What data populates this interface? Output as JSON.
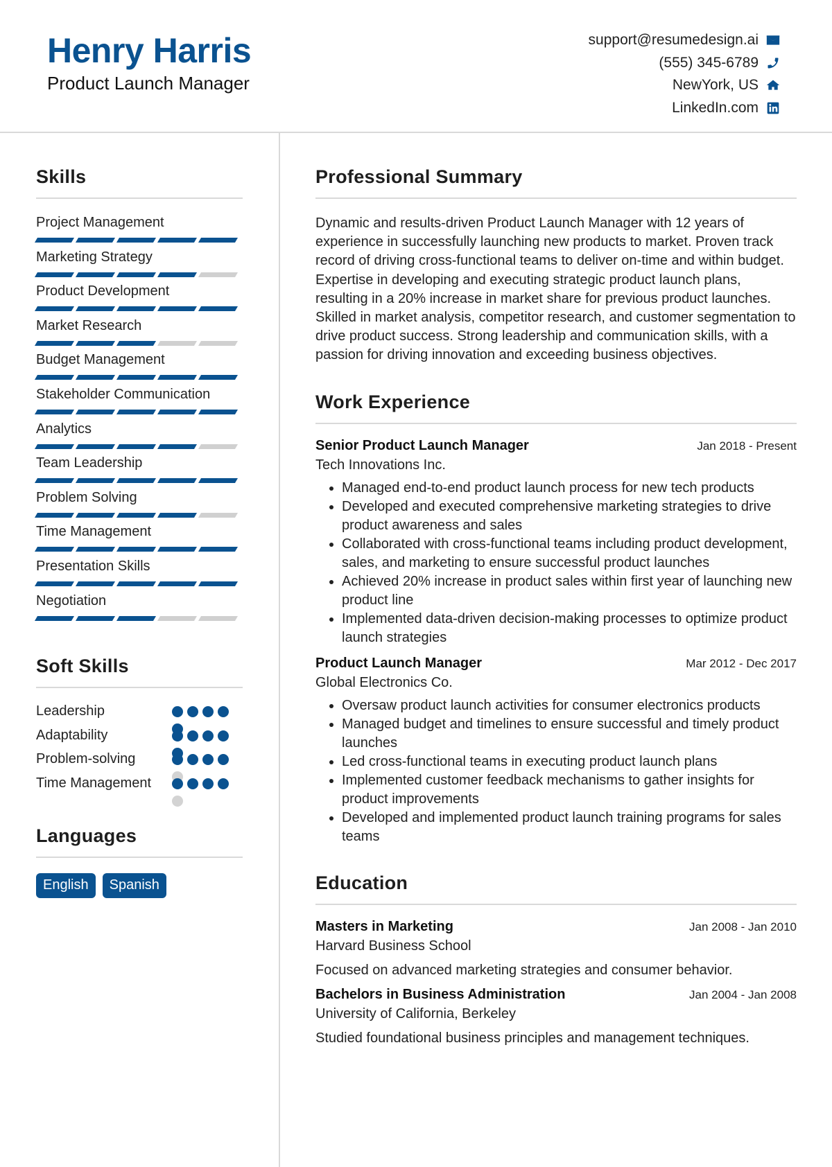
{
  "header": {
    "name": "Henry Harris",
    "title": "Product Launch Manager",
    "contacts": [
      {
        "text": "support@resumedesign.ai",
        "icon": "envelope-icon"
      },
      {
        "text": "(555) 345-6789",
        "icon": "phone-icon"
      },
      {
        "text": "NewYork, US",
        "icon": "home-icon"
      },
      {
        "text": "LinkedIn.com",
        "icon": "linkedin-icon"
      }
    ]
  },
  "colors": {
    "accent": "#0a5290",
    "inactive": "#d3d3d3",
    "rule": "#d9d9d9"
  },
  "skills": {
    "title": "Skills",
    "max": 5,
    "items": [
      {
        "label": "Project Management",
        "level": 5
      },
      {
        "label": "Marketing Strategy",
        "level": 4
      },
      {
        "label": "Product Development",
        "level": 5
      },
      {
        "label": "Market Research",
        "level": 3
      },
      {
        "label": "Budget Management",
        "level": 5
      },
      {
        "label": "Stakeholder Communication",
        "level": 5
      },
      {
        "label": "Analytics",
        "level": 4
      },
      {
        "label": "Team Leadership",
        "level": 5
      },
      {
        "label": "Problem Solving",
        "level": 4
      },
      {
        "label": "Time Management",
        "level": 5
      },
      {
        "label": "Presentation Skills",
        "level": 5
      },
      {
        "label": "Negotiation",
        "level": 3
      }
    ]
  },
  "soft_skills": {
    "title": "Soft Skills",
    "max": 5,
    "items": [
      {
        "label": "Leadership",
        "level": 5
      },
      {
        "label": "Adaptability",
        "level": 5
      },
      {
        "label": "Problem-solving",
        "level": 4
      },
      {
        "label": "Time Management",
        "level": 4
      }
    ]
  },
  "languages": {
    "title": "Languages",
    "items": [
      "English",
      "Spanish"
    ]
  },
  "summary": {
    "title": "Professional Summary",
    "text": "Dynamic and results-driven Product Launch Manager with 12 years of experience in successfully launching new products to market. Proven track record of driving cross-functional teams to deliver on-time and within budget. Expertise in developing and executing strategic product launch plans, resulting in a 20% increase in market share for previous product launches. Skilled in market analysis, competitor research, and customer segmentation to drive product success. Strong leadership and communication skills, with a passion for driving innovation and exceeding business objectives."
  },
  "experience": {
    "title": "Work Experience",
    "jobs": [
      {
        "title": "Senior Product Launch Manager",
        "date": "Jan 2018 - Present",
        "company": "Tech Innovations Inc.",
        "bullets": [
          "Managed end-to-end product launch process for new tech products",
          "Developed and executed comprehensive marketing strategies to drive product awareness and sales",
          "Collaborated with cross-functional teams including product development, sales, and marketing to ensure successful product launches",
          "Achieved 20% increase in product sales within first year of launching new product line",
          "Implemented data-driven decision-making processes to optimize product launch strategies"
        ]
      },
      {
        "title": "Product Launch Manager",
        "date": "Mar 2012 - Dec 2017",
        "company": "Global Electronics Co.",
        "bullets": [
          "Oversaw product launch activities for consumer electronics products",
          "Managed budget and timelines to ensure successful and timely product launches",
          "Led cross-functional teams in executing product launch plans",
          "Implemented customer feedback mechanisms to gather insights for product improvements",
          "Developed and implemented product launch training programs for sales teams"
        ]
      }
    ]
  },
  "education": {
    "title": "Education",
    "items": [
      {
        "degree": "Masters in Marketing",
        "date": "Jan 2008 - Jan 2010",
        "school": "Harvard Business School",
        "description": "Focused on advanced marketing strategies and consumer behavior."
      },
      {
        "degree": "Bachelors in Business Administration",
        "date": "Jan 2004 - Jan 2008",
        "school": "University of California, Berkeley",
        "description": "Studied foundational business principles and management techniques."
      }
    ]
  }
}
